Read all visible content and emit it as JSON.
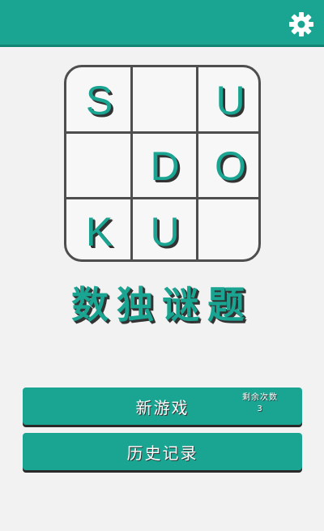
{
  "topbar": {
    "settings_icon": "gear-icon",
    "accent": "#1aa592"
  },
  "logo": {
    "cells": [
      "S",
      "",
      "U",
      "",
      "D",
      "O",
      "K",
      "U",
      ""
    ]
  },
  "title": "数独谜题",
  "buttons": {
    "new_game": {
      "label": "新游戏",
      "remaining_label": "剩余次数",
      "remaining_count": "3"
    },
    "history": {
      "label": "历史记录"
    }
  }
}
